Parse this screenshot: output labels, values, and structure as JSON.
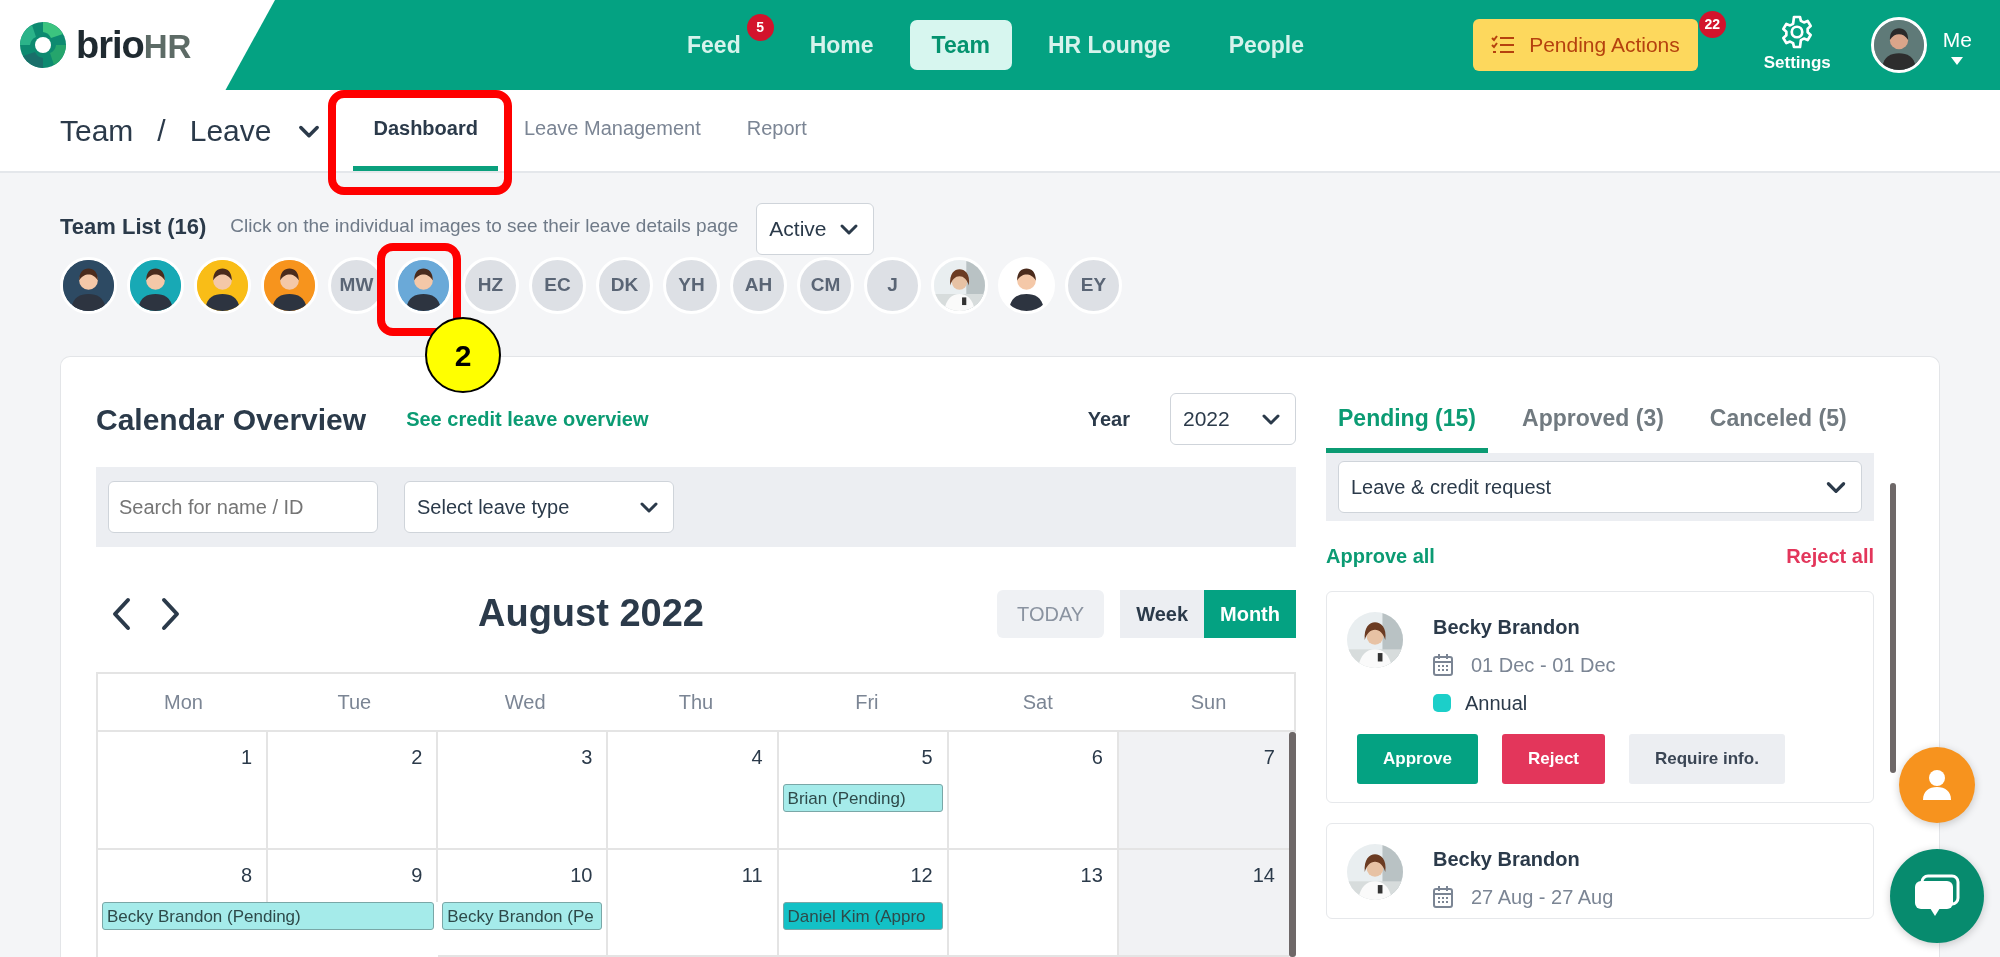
{
  "brand": {
    "name": "brio",
    "suffix": "HR"
  },
  "nav": [
    {
      "label": "Feed",
      "badge": "5",
      "selected": false
    },
    {
      "label": "Home",
      "selected": false
    },
    {
      "label": "Team",
      "selected": true
    },
    {
      "label": "HR Lounge",
      "selected": false
    },
    {
      "label": "People",
      "selected": false
    }
  ],
  "pending_actions": {
    "label": "Pending Actions",
    "badge": "22"
  },
  "settings": {
    "label": "Settings"
  },
  "profile": {
    "label": "Me"
  },
  "breadcrumb": {
    "section": "Team",
    "separator": "/",
    "page": "Leave"
  },
  "subtabs": [
    {
      "label": "Dashboard",
      "selected": true,
      "highlighted": true
    },
    {
      "label": "Leave Management",
      "selected": false,
      "highlighted": false
    },
    {
      "label": "Report",
      "selected": false,
      "highlighted": false
    }
  ],
  "team_list": {
    "title": "Team List (16)",
    "hint": "Click on the individual images to see their leave details page",
    "filter": "Active",
    "members": [
      {
        "kind": "avatar",
        "color": "#2d4a63",
        "highlighted": false
      },
      {
        "kind": "avatar",
        "color": "#18a9b5",
        "highlighted": false
      },
      {
        "kind": "avatar",
        "color": "#f9bd17",
        "highlighted": false
      },
      {
        "kind": "avatar",
        "color": "#f7941d",
        "highlighted": false
      },
      {
        "kind": "initials",
        "initials": "MW",
        "highlighted": false
      },
      {
        "kind": "avatar",
        "color": "#6aa9d8",
        "highlighted": true,
        "step": "2"
      },
      {
        "kind": "initials",
        "initials": "HZ",
        "highlighted": false
      },
      {
        "kind": "initials",
        "initials": "EC",
        "highlighted": false
      },
      {
        "kind": "initials",
        "initials": "DK",
        "highlighted": false
      },
      {
        "kind": "initials",
        "initials": "YH",
        "highlighted": false
      },
      {
        "kind": "initials",
        "initials": "AH",
        "highlighted": false
      },
      {
        "kind": "initials",
        "initials": "CM",
        "highlighted": false
      },
      {
        "kind": "initials",
        "initials": "J",
        "highlighted": false
      },
      {
        "kind": "picture",
        "highlighted": false
      },
      {
        "kind": "avatar",
        "color": "#ffffff",
        "highlighted": false
      },
      {
        "kind": "initials",
        "initials": "EY",
        "highlighted": false
      }
    ]
  },
  "calendar": {
    "title": "Calendar Overview",
    "link": "See credit leave overview",
    "year_label": "Year",
    "year": "2022",
    "search_placeholder": "Search for name / ID",
    "leave_type": "Select leave type",
    "month": "August 2022",
    "today": "TODAY",
    "views": [
      {
        "label": "Week",
        "selected": false
      },
      {
        "label": "Month",
        "selected": true
      }
    ],
    "weekdays": [
      "Mon",
      "Tue",
      "Wed",
      "Thu",
      "Fri",
      "Sat",
      "Sun"
    ],
    "weeks": [
      {
        "days": [
          {
            "date": "1",
            "off": false
          },
          {
            "date": "2",
            "off": false
          },
          {
            "date": "3",
            "off": false
          },
          {
            "date": "4",
            "off": false
          },
          {
            "date": "5",
            "off": false,
            "events": [
              {
                "label": "Brian (Pending)",
                "color": "#a5ebea",
                "spans_next": false
              }
            ]
          },
          {
            "date": "6",
            "off": false
          },
          {
            "date": "7",
            "off": true
          }
        ]
      },
      {
        "days": [
          {
            "date": "8",
            "off": false,
            "events": [
              {
                "label": "Becky Brandon (Pending)",
                "color": "#a5ebea",
                "spans_next": true
              }
            ]
          },
          {
            "date": "9",
            "off": false
          },
          {
            "date": "10",
            "off": false,
            "events": [
              {
                "label": "Becky Brandon (Pe",
                "color": "#a5ebea",
                "spans_next": false
              }
            ]
          },
          {
            "date": "11",
            "off": false
          },
          {
            "date": "12",
            "off": false,
            "events": [
              {
                "label": "Daniel Kim (Appro",
                "color": "#13c1c6",
                "spans_next": false
              }
            ]
          },
          {
            "date": "13",
            "off": false
          },
          {
            "date": "14",
            "off": true
          }
        ]
      }
    ]
  },
  "requests_panel": {
    "tabs": [
      {
        "label": "Pending (15)",
        "selected": true
      },
      {
        "label": "Approved (3)",
        "selected": false
      },
      {
        "label": "Canceled (5)",
        "selected": false
      }
    ],
    "request_type": "Leave & credit request",
    "approve_all": "Approve all",
    "reject_all": "Reject all",
    "requests": [
      {
        "name": "Becky Brandon",
        "dates": "01 Dec - 01 Dec",
        "type": "Annual",
        "color": "#1ccfc9",
        "actions": [
          {
            "label": "Approve",
            "kind": "approve"
          },
          {
            "label": "Reject",
            "kind": "reject"
          },
          {
            "label": "Require info.",
            "kind": "info"
          }
        ]
      },
      {
        "name": "Becky Brandon",
        "dates": "27 Aug - 27 Aug"
      }
    ]
  }
}
